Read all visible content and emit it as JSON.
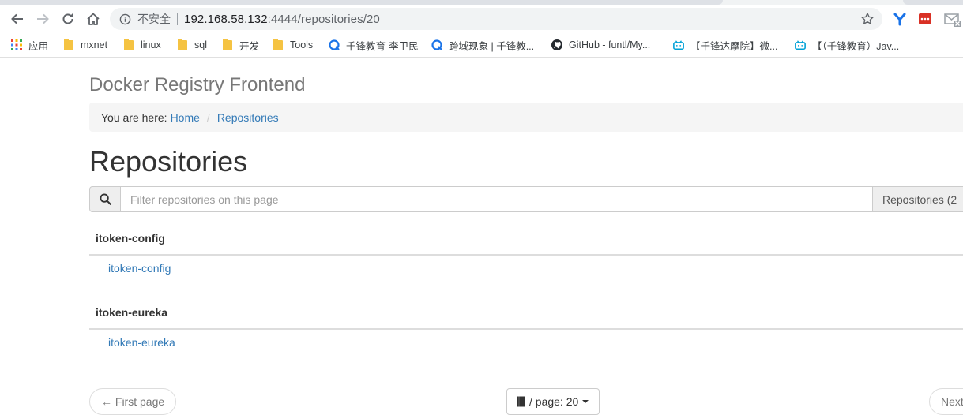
{
  "browser": {
    "insecure_label": "不安全",
    "url_host": "192.168.58.132",
    "url_rest": ":4444/repositories/20",
    "icons": [
      "back-icon",
      "forward-icon",
      "reload-icon",
      "home-icon",
      "info-icon",
      "star-icon"
    ]
  },
  "bookmarks": [
    {
      "label": "应用",
      "icon": "apps-grid-icon"
    },
    {
      "label": "mxnet",
      "icon": "folder-icon"
    },
    {
      "label": "linux",
      "icon": "folder-icon"
    },
    {
      "label": "sql",
      "icon": "folder-icon"
    },
    {
      "label": "开发",
      "icon": "folder-icon"
    },
    {
      "label": "Tools",
      "icon": "folder-icon"
    },
    {
      "label": "千锋教育-李卫民",
      "icon": "site-icon"
    },
    {
      "label": "跨域现象 | 千锋教...",
      "icon": "site-icon"
    },
    {
      "label": "GitHub - funtl/My...",
      "icon": "github-icon"
    },
    {
      "label": "【千锋达摩院】微...",
      "icon": "bilibili-icon"
    },
    {
      "label": "【（千锋教育）Jav...",
      "icon": "bilibili-icon"
    }
  ],
  "app": {
    "brand": "Docker Registry Frontend"
  },
  "breadcrumb": {
    "prefix": "You are here:",
    "home": "Home",
    "separator": "/",
    "current": "Repositories"
  },
  "main": {
    "title": "Repositories",
    "filter_placeholder": "Filter repositories on this page",
    "count_label": "Repositories (2"
  },
  "groups": [
    {
      "name": "itoken-config",
      "repos": [
        "itoken-config"
      ]
    },
    {
      "name": "itoken-eureka",
      "repos": [
        "itoken-eureka"
      ]
    }
  ],
  "pager": {
    "first": "← First page",
    "page_label": "/ page: 20",
    "next": "Next"
  },
  "colors": {
    "link": "#337ab7",
    "brand_text": "#777777",
    "breadcrumb_bg": "#f5f5f5"
  }
}
